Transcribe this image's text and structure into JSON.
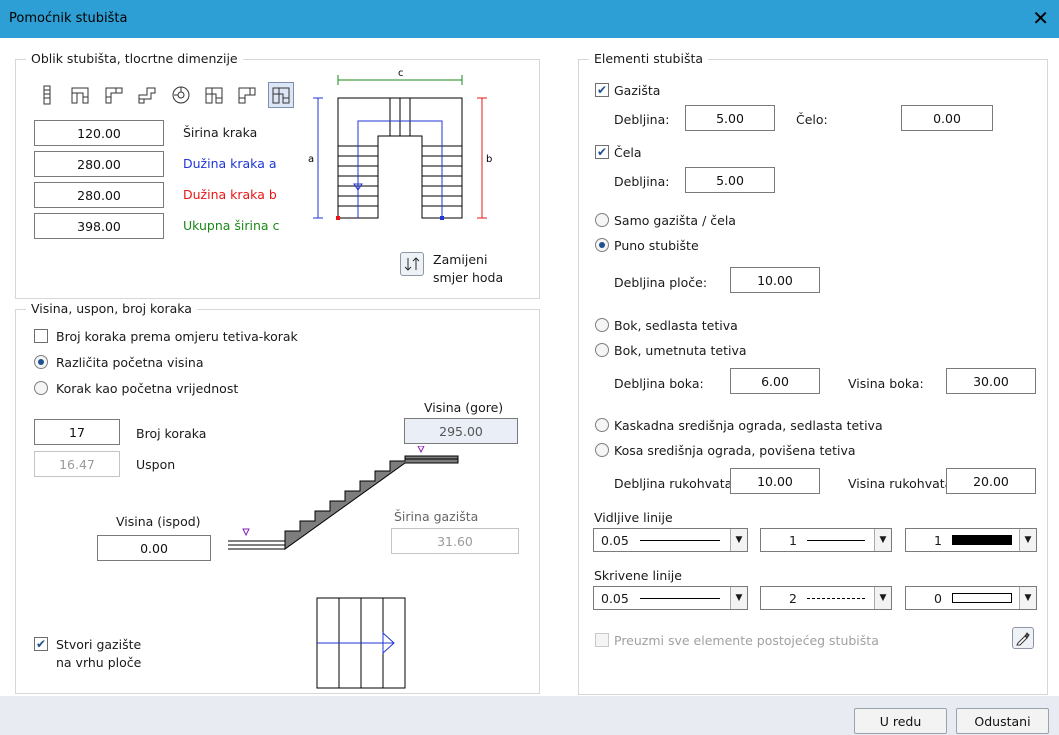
{
  "window": {
    "title": "Pomoćnik stubišta",
    "close_glyph": "✕"
  },
  "shape_group": {
    "legend": "Oblik stubišta, tlocrtne dimenzije",
    "shapes": [
      "straight-stair-icon",
      "l-stair-icon",
      "l-stair-alt-icon",
      "double-landing-stair-icon",
      "spiral-stair-icon",
      "u-stair-icon",
      "l-stair-wide-icon",
      "u-stair-selected-icon"
    ],
    "fields": [
      {
        "value": "120.00",
        "label": "Širina kraka",
        "color": "#1a1a1a"
      },
      {
        "value": "280.00",
        "label": "Dužina kraka a",
        "color": "#1f35d6"
      },
      {
        "value": "280.00",
        "label": "Dužina kraka b",
        "color": "#e81616"
      },
      {
        "value": "398.00",
        "label": "Ukupna širina c",
        "color": "#1b8a17"
      }
    ],
    "plan_labels": {
      "a": "a",
      "b": "b",
      "c": "c"
    },
    "swap_label_1": "Zamijeni",
    "swap_label_2": "smjer hoda"
  },
  "height_group": {
    "legend": "Visina, uspon, broj koraka",
    "checkbox_ratio": "Broj koraka prema omjeru tetiva-korak",
    "radio_different_height": "Različita početna visina",
    "radio_step_start": "Korak kao početna vrijednost",
    "steps_value": "17",
    "steps_label": "Broj koraka",
    "rise_value": "16.47",
    "rise_label": "Uspon",
    "top_height_label": "Visina (gore)",
    "top_height_value": "295.00",
    "bottom_height_label": "Visina (ispod)",
    "bottom_height_value": "0.00",
    "tread_width_label": "Širina gazišta",
    "tread_width_value": "31.60",
    "create_tread_line1": "Stvori gazište",
    "create_tread_line2": "na vrhu ploče"
  },
  "elements_group": {
    "legend": "Elementi stubišta",
    "treads_label": "Gazišta",
    "treads_thickness_label": "Debljina:",
    "treads_thickness_value": "5.00",
    "front_label": "Čelo:",
    "front_value": "0.00",
    "risers_label": "Čela",
    "risers_thickness_label": "Debljina:",
    "risers_thickness_value": "5.00",
    "radio_treads_only": "Samo gazišta / čela",
    "radio_full_stair": "Puno stubište",
    "slab_thickness_label": "Debljina ploče:",
    "slab_thickness_value": "10.00",
    "radio_saddle_stringer": "Bok, sedlasta tetiva",
    "radio_inset_stringer": "Bok, umetnuta tetiva",
    "side_thickness_label": "Debljina boka:",
    "side_thickness_value": "6.00",
    "side_height_label": "Visina boka:",
    "side_height_value": "30.00",
    "radio_cascade_rail": "Kaskadna središnja ograda, sedlasta tetiva",
    "radio_sloped_rail": "Kosa središnja ograda, povišena tetiva",
    "handrail_thickness_label": "Debljina rukohvata",
    "handrail_thickness_value": "10.00",
    "handrail_height_label": "Visina rukohvata",
    "handrail_height_value": "20.00",
    "visible_lines_label": "Vidljive linije",
    "visible_lines": [
      "0.05",
      "1",
      "1"
    ],
    "hidden_lines_label": "Skrivene linije",
    "hidden_lines": [
      "0.05",
      "2",
      "0"
    ],
    "adopt_all_label": "Preuzmi sve elemente postojećeg stubišta"
  },
  "footer": {
    "ok_label": "U redu",
    "cancel_label": "Odustani"
  },
  "colors": {
    "titlebar": "#2e9fd4",
    "blue": "#1f35d6",
    "red": "#e81616",
    "green": "#1b8a17",
    "purple": "#8a1fb5"
  }
}
